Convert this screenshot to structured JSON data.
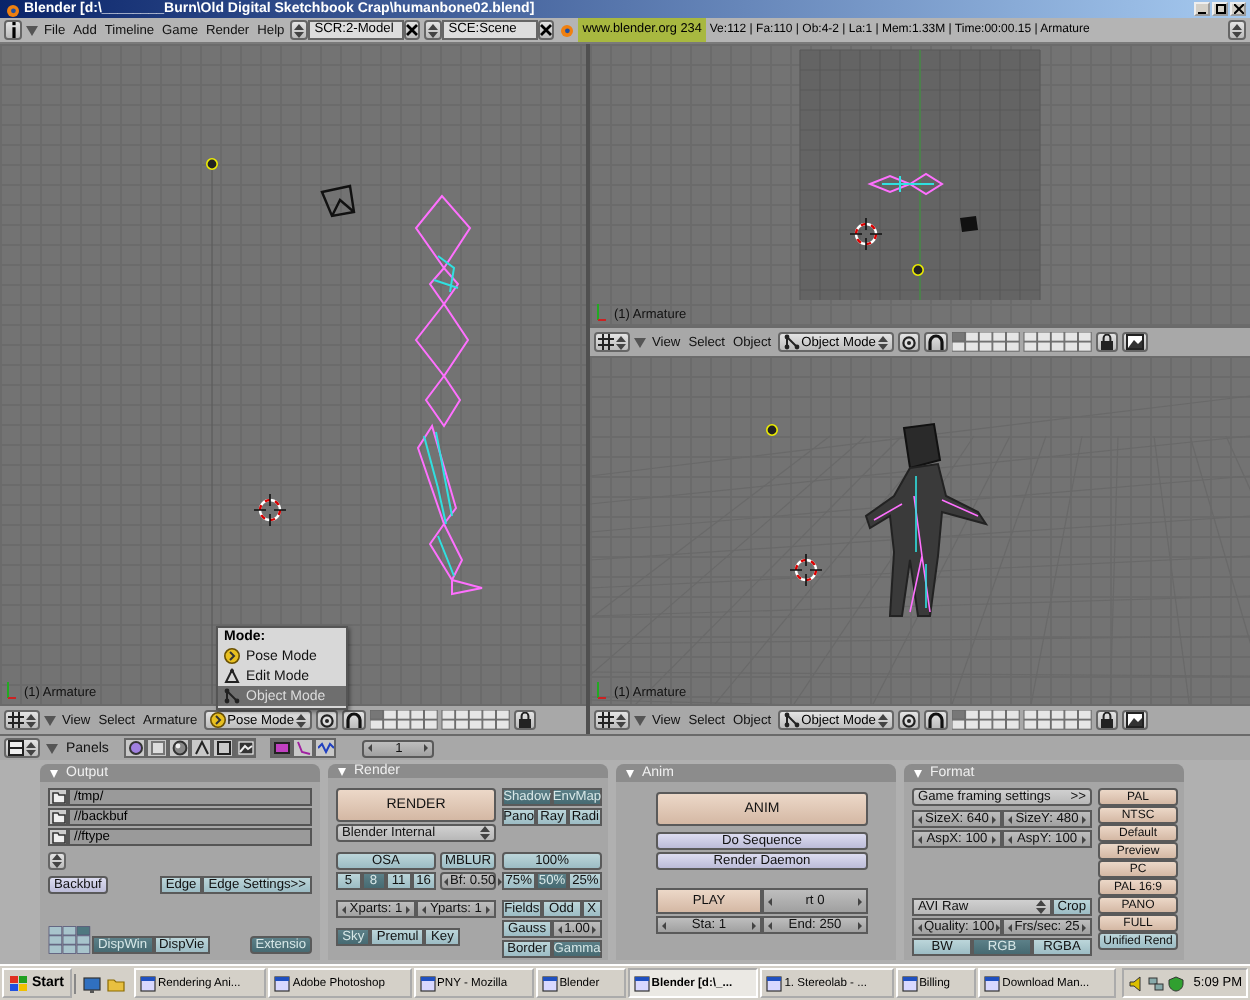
{
  "window": {
    "title": "Blender [d:\\________Burn\\Old Digital Sketchbook Crap\\humanbone02.blend]"
  },
  "info_header": {
    "menus": [
      "File",
      "Add",
      "Timeline",
      "Game",
      "Render",
      "Help"
    ],
    "screen": "SCR:2-Model",
    "scene": "SCE:Scene",
    "version": "www.blender.org 234",
    "stats": "Ve:112 | Fa:110 | Ob:4-2 | La:1 | Mem:1.33M | Time:00:00.15 | Armature"
  },
  "viewports": [
    {
      "kind": "side",
      "label": "(1) Armature",
      "menus": [
        "View",
        "Select",
        "Armature"
      ],
      "mode": {
        "label": "Pose Mode",
        "kind": "pose"
      }
    },
    {
      "kind": "top",
      "label": "(1) Armature",
      "menus": [
        "View",
        "Select",
        "Object"
      ],
      "mode": {
        "label": "Object Mode",
        "kind": "object"
      }
    },
    {
      "kind": "perspective",
      "label": "(1) Armature",
      "menus": [
        "View",
        "Select",
        "Object"
      ],
      "mode": {
        "label": "Object Mode",
        "kind": "object"
      }
    }
  ],
  "mode_menu": {
    "title": "Mode:",
    "items": [
      {
        "label": "Pose Mode",
        "kind": "pose",
        "selected": false
      },
      {
        "label": "Edit Mode",
        "kind": "edit",
        "selected": false
      },
      {
        "label": "Object Mode",
        "kind": "object",
        "selected": true
      }
    ]
  },
  "buttons_header": {
    "menu": "Panels",
    "frame": "1"
  },
  "output": {
    "title": "Output",
    "paths": [
      "/tmp/",
      "//backbuf",
      "//ftype"
    ],
    "backbuf": {
      "label": "Backbuf",
      "kind": "action"
    },
    "edge": {
      "label": "Edge",
      "kind": "toggle",
      "on": false
    },
    "edge_settings": {
      "label": "Edge Settings>>",
      "kind": "toggle",
      "on": false
    },
    "disp_win": {
      "label": "DispWin",
      "kind": "toggle",
      "selected": true
    },
    "disp_view": {
      "label": "DispVie",
      "kind": "toggle",
      "selected": false
    },
    "extension": {
      "label": "Extensio",
      "kind": "toggle",
      "on": true
    }
  },
  "render": {
    "title": "Render",
    "render": {
      "label": "RENDER",
      "kind": "push"
    },
    "engine": {
      "label": "Blender Internal",
      "kind": "menu"
    },
    "shading": [
      [
        {
          "label": "Shadow",
          "kind": "toggle",
          "on": true
        },
        {
          "label": "EnvMap",
          "kind": "toggle",
          "on": true
        }
      ],
      [
        {
          "label": "Pano",
          "kind": "toggle",
          "on": false
        },
        {
          "label": "Ray",
          "kind": "toggle",
          "on": false
        },
        {
          "label": "Radi",
          "kind": "toggle",
          "on": false
        }
      ]
    ],
    "osa": {
      "label": "OSA",
      "kind": "toggle",
      "on": false
    },
    "osa_levels": [
      {
        "label": "5",
        "kind": "toggle",
        "selected": false
      },
      {
        "label": "8",
        "kind": "toggle",
        "selected": true
      },
      {
        "label": "11",
        "kind": "toggle",
        "selected": false
      },
      {
        "label": "16",
        "kind": "toggle",
        "selected": false
      }
    ],
    "mblur": {
      "label": "MBLUR",
      "kind": "toggle",
      "on": false
    },
    "blur_factor": {
      "label": "Bf: 0.50",
      "kind": "number"
    },
    "size": {
      "label": "100%",
      "kind": "label"
    },
    "sizes": [
      {
        "label": "75%",
        "kind": "toggle",
        "selected": false
      },
      {
        "label": "50%",
        "kind": "toggle",
        "selected": true
      },
      {
        "label": "25%",
        "kind": "toggle",
        "selected": false
      }
    ],
    "parts": [
      {
        "label": "Xparts: 1",
        "kind": "number"
      },
      {
        "label": "Yparts: 1",
        "kind": "number"
      }
    ],
    "fields": [
      [
        {
          "label": "Fields",
          "kind": "toggle",
          "on": false
        },
        {
          "label": "Odd",
          "kind": "toggle",
          "on": false
        },
        {
          "label": "X",
          "kind": "toggle",
          "on": false
        }
      ],
      [
        {
          "label": "Gauss",
          "kind": "toggle",
          "on": false
        },
        {
          "label": "1.00",
          "kind": "number"
        }
      ],
      [
        {
          "label": "Border",
          "kind": "toggle",
          "on": false
        },
        {
          "label": "Gamma",
          "kind": "toggle",
          "on": true
        }
      ]
    ],
    "alpha": [
      {
        "label": "Sky",
        "kind": "toggle",
        "selected": true
      },
      {
        "label": "Premul",
        "kind": "toggle",
        "selected": false
      },
      {
        "label": "Key",
        "kind": "toggle",
        "selected": false
      }
    ]
  },
  "anim": {
    "title": "Anim",
    "anim": {
      "label": "ANIM",
      "kind": "push"
    },
    "do_sequence": {
      "label": "Do Sequence",
      "kind": "action"
    },
    "render_daemon": {
      "label": "Render Daemon",
      "kind": "action"
    },
    "play": {
      "label": "PLAY",
      "kind": "push"
    },
    "rt": {
      "label": "rt 0",
      "kind": "number"
    },
    "start": {
      "label": "Sta: 1",
      "kind": "number"
    },
    "end": {
      "label": "End: 250",
      "kind": "number"
    }
  },
  "format": {
    "title": "Format",
    "game_framing": "Game framing settings",
    "game_framing_more": ">>",
    "size": [
      {
        "label": "SizeX: 640",
        "kind": "number"
      },
      {
        "label": "SizeY: 480",
        "kind": "number"
      }
    ],
    "aspect": [
      {
        "label": "AspX: 100",
        "kind": "number"
      },
      {
        "label": "AspY: 100",
        "kind": "number"
      }
    ],
    "codec": {
      "label": "AVI Raw",
      "kind": "menu"
    },
    "crop": {
      "label": "Crop",
      "kind": "toggle",
      "on": false
    },
    "quality": {
      "label": "Quality: 100",
      "kind": "number"
    },
    "fps": {
      "label": "Frs/sec: 25",
      "kind": "number"
    },
    "color_modes": [
      {
        "label": "BW",
        "kind": "toggle",
        "selected": false
      },
      {
        "label": "RGB",
        "kind": "toggle",
        "selected": true
      },
      {
        "label": "RGBA",
        "kind": "toggle",
        "selected": false
      }
    ],
    "presets": [
      {
        "label": "PAL",
        "kind": "push"
      },
      {
        "label": "NTSC",
        "kind": "push"
      },
      {
        "label": "Default",
        "kind": "push"
      },
      {
        "label": "Preview",
        "kind": "push"
      },
      {
        "label": "PC",
        "kind": "push"
      },
      {
        "label": "PAL 16:9",
        "kind": "push"
      },
      {
        "label": "PANO",
        "kind": "push"
      },
      {
        "label": "FULL",
        "kind": "push"
      },
      {
        "label": "Unified Rend",
        "kind": "toggle",
        "on": false
      }
    ]
  },
  "taskbar": {
    "start": "Start",
    "tasks": [
      {
        "label": "Rendering Ani...",
        "selected": false
      },
      {
        "label": "Adobe Photoshop",
        "selected": false
      },
      {
        "label": "PNY - Mozilla",
        "selected": false
      },
      {
        "label": "Blender",
        "selected": false
      },
      {
        "label": "Blender [d:\\_...",
        "selected": true
      },
      {
        "label": "1. Stereolab - ...",
        "selected": false
      },
      {
        "label": "Billing",
        "selected": false
      },
      {
        "label": "Download Man...",
        "selected": false
      }
    ],
    "clock": "5:09 PM"
  }
}
